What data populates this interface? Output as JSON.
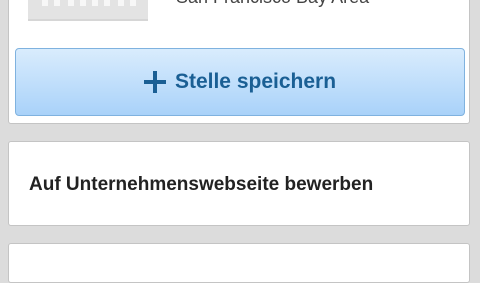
{
  "company": {
    "location": "San Francisco Bay Area",
    "logo_icon": "building-logo-icon"
  },
  "actions": {
    "save_label": "Stelle speichern",
    "save_icon": "plus-icon",
    "apply_label": "Auf Unternehmenswebseite bewerben"
  },
  "colors": {
    "background": "#dcdcdc",
    "card": "#ffffff",
    "button_text": "#1a5f94",
    "button_gradient_top": "#d9ecfd",
    "button_gradient_bottom": "#a9d2f9"
  }
}
